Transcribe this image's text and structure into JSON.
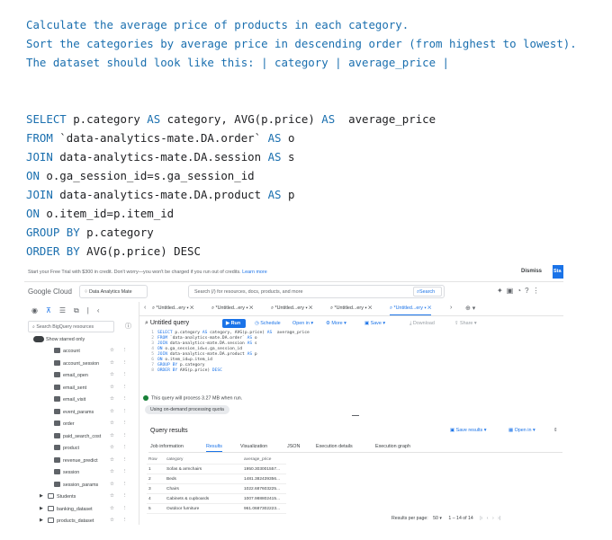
{
  "instructions": [
    "Calculate the average price of products in each category.",
    "Sort the categories by average price in descending order (from highest to lowest).",
    "The dataset should look like this: | category | average_price |"
  ],
  "sql": [
    {
      "kw": "SELECT",
      "rest": " p.category ",
      "kw2": "AS",
      "rest2": " category, AVG(p.price) ",
      "kw3": "AS",
      "rest3": "  average_price"
    },
    {
      "kw": "FROM",
      "rest": " `data-analytics-mate.DA.order` ",
      "kw2": "AS",
      "rest2": " o",
      "kw3": "",
      "rest3": ""
    },
    {
      "kw": "JOIN",
      "rest": " data-analytics-mate.DA.session ",
      "kw2": "AS",
      "rest2": " s",
      "kw3": "",
      "rest3": ""
    },
    {
      "kw": "ON",
      "rest": " o.ga_session_id=s.ga_session_id",
      "kw2": "",
      "rest2": "",
      "kw3": "",
      "rest3": ""
    },
    {
      "kw": "JOIN",
      "rest": " data-analytics-mate.DA.product ",
      "kw2": "AS",
      "rest2": " p",
      "kw3": "",
      "rest3": ""
    },
    {
      "kw": "ON",
      "rest": " o.item_id=p.item_id",
      "kw2": "",
      "rest2": "",
      "kw3": "",
      "rest3": ""
    },
    {
      "kw": "GROUP BY",
      "rest": " p.category",
      "kw2": "",
      "rest2": "",
      "kw3": "",
      "rest3": ""
    },
    {
      "kw": "ORDER BY",
      "rest": " AVG(p.price) DESC",
      "kw2": "",
      "rest2": "",
      "kw3": "",
      "rest3": ""
    }
  ],
  "console": {
    "banner": {
      "text": "Start your Free Trial with $300 in credit. Don't worry—you won't be charged if you run out of credits. ",
      "link": "Learn more",
      "dismiss": "Dismiss",
      "start": "Sta"
    },
    "logo": "Google Cloud",
    "project": "Data Analytics Mate",
    "search_placeholder": "Search (/) for resources, docs, products, and more",
    "search_button": "Search",
    "explorer": {
      "search_placeholder": "Search BigQuery resources",
      "starred_label": "Show starred only",
      "tables": [
        "account",
        "account_session",
        "email_open",
        "email_sent",
        "email_visit",
        "event_params",
        "order",
        "paid_search_cost",
        "product",
        "revenue_predict",
        "session",
        "session_params"
      ],
      "datasets": [
        "Students",
        "banking_dataset",
        "products_dataset"
      ]
    },
    "tabs": [
      "*Untitled...ery",
      "*Untitled...ery",
      "*Untitled...ery",
      "*Untitled...ery",
      "*Untitled...ery"
    ],
    "editor": {
      "title": "Untitled query",
      "run": "Run",
      "schedule": "Schedule",
      "open_in": "Open in",
      "more": "More",
      "save": "Save",
      "download": "Download",
      "share": "Share",
      "lines": [
        "SELECT p.category AS category, AVG(p.price) AS  average_price",
        "FROM `data-analytics-mate.DA.order` AS o",
        "JOIN data-analytics-mate.DA.session AS s",
        "ON o.ga_session_id=s.ga_session_id",
        "JOIN data-analytics-mate.DA.product AS p",
        "ON o.item_id=p.item_id",
        "GROUP BY p.category",
        "ORDER BY AVG(p.price) DESC"
      ],
      "line_numbers": [
        "1",
        "2",
        "3",
        "4",
        "5",
        "6",
        "7",
        "8"
      ],
      "process_msg": "This query will process 3.27 MB when run.",
      "pricing": "Using on-demand processing quota"
    },
    "results": {
      "title": "Query results",
      "save_results": "Save results",
      "open_in": "Open in",
      "tabs": [
        "Job information",
        "Results",
        "Visualization",
        "JSON",
        "Execution details",
        "Execution graph"
      ],
      "columns": [
        "Row",
        "category",
        "average_price"
      ],
      "rows": [
        [
          "1",
          "Sofas & armchairs",
          "1950.303001557..."
        ],
        [
          "2",
          "Beds",
          "1481.382439356..."
        ],
        [
          "3",
          "Chairs",
          "1022.687603225..."
        ],
        [
          "4",
          "Cabinets & cupboards",
          "1007.988802415..."
        ],
        [
          "5",
          "Outdoor furniture",
          "961.0687302223..."
        ]
      ],
      "pager_label": "Results per page:",
      "pager_value": "50",
      "pager_range": "1 – 14 of 14"
    }
  }
}
